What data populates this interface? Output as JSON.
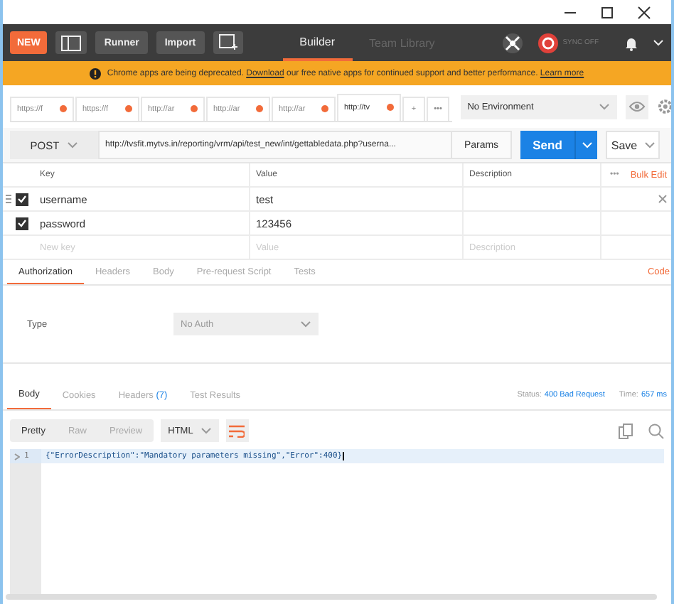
{
  "header": {
    "new_button": "NEW",
    "buttons": [
      "Runner",
      "Import"
    ],
    "tabs": [
      {
        "label": "Builder",
        "selected": true
      },
      {
        "label": "Team Library",
        "selected": false
      }
    ],
    "sync": "SYNC OFF"
  },
  "banner": {
    "parts": [
      {
        "text": "Chrome apps are being deprecated. ",
        "kind": "text"
      },
      {
        "text": "Download",
        "kind": "link"
      },
      {
        "text": " our free native apps for continued support and better performance. ",
        "kind": "text"
      },
      {
        "text": "Learn more",
        "kind": "link"
      }
    ]
  },
  "request_tabs": [
    {
      "label": "https://f",
      "selected": false,
      "unsaved": true
    },
    {
      "label": "https://f",
      "selected": false,
      "unsaved": true
    },
    {
      "label": "http://ar",
      "selected": false,
      "unsaved": true
    },
    {
      "label": "http://ar",
      "selected": false,
      "unsaved": true
    },
    {
      "label": "http://ar",
      "selected": false,
      "unsaved": true
    },
    {
      "label": "http://tv",
      "selected": true,
      "unsaved": true
    }
  ],
  "new_tab": "+",
  "more_tabs": "•••",
  "environment": {
    "value": "No Environment"
  },
  "request": {
    "method": "POST",
    "url": "http://tvsfit.mytvs.in/reporting/vrm/api/test_new/int/gettabledata.php?userna...",
    "params_button": "Params",
    "send_button": "Send",
    "save_button": "Save"
  },
  "params": {
    "columns": [
      "Key",
      "Value",
      "Description"
    ],
    "more": "•••",
    "bulk_edit": "Bulk Edit",
    "rows": [
      {
        "key": "username",
        "value": "test",
        "checked": true
      },
      {
        "key": "password",
        "value": "123456",
        "checked": true
      }
    ],
    "new_row": {
      "key_placeholder": "New key",
      "value_placeholder": "Value",
      "description_placeholder": "Description"
    }
  },
  "request_section_tabs": [
    {
      "label": "Authorization",
      "selected": true
    },
    {
      "label": "Headers",
      "selected": false
    },
    {
      "label": "Body",
      "selected": false
    },
    {
      "label": "Pre-request Script",
      "selected": false
    },
    {
      "label": "Tests",
      "selected": false
    }
  ],
  "code_link": "Code",
  "auth": {
    "label": "Type",
    "value": "No Auth"
  },
  "response": {
    "tabs": [
      {
        "label": "Body",
        "selected": true
      },
      {
        "label": "Cookies",
        "selected": false
      },
      {
        "label": "Headers",
        "count": "(7)",
        "selected": false
      },
      {
        "label": "Test Results",
        "selected": false
      }
    ],
    "status_label": "Status:",
    "status": "400 Bad Request",
    "time_label": "Time:",
    "time": "657 ms",
    "view_modes": [
      {
        "label": "Pretty",
        "selected": true
      },
      {
        "label": "Raw",
        "selected": false
      },
      {
        "label": "Preview",
        "selected": false
      }
    ],
    "format": "HTML",
    "lines": [
      {
        "number": "1",
        "text": "{\"ErrorDescription\":\"Mandatory parameters missing\",\"Error\":400}"
      }
    ]
  }
}
